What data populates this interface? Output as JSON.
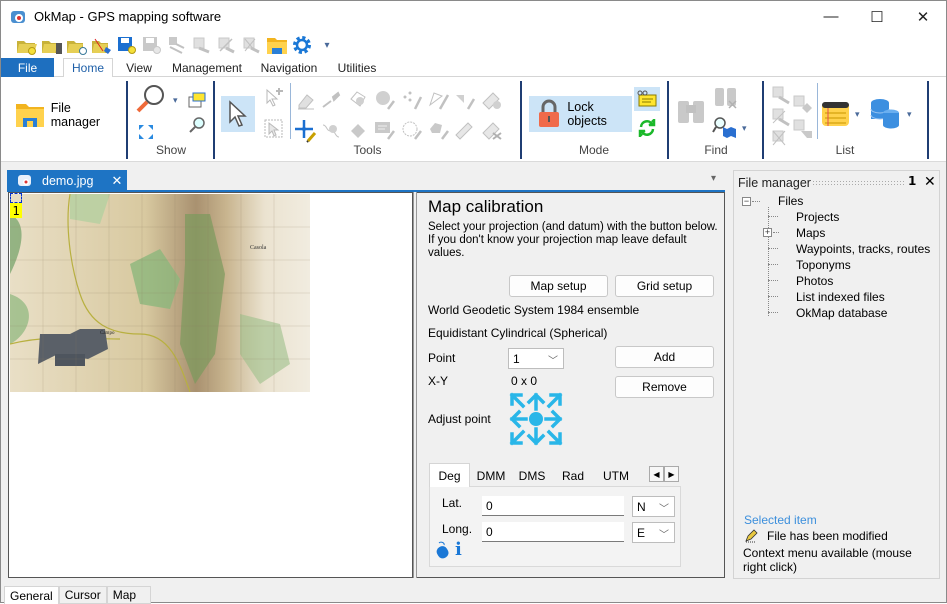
{
  "window": {
    "title": "OkMap - GPS mapping software",
    "controls": {
      "minimize": "—",
      "maximize": "☐",
      "close": "✕"
    }
  },
  "quick_access": {
    "items": [
      "open-project-icon",
      "open-device-icon",
      "open-web-icon",
      "open-track-icon",
      "save-icon",
      "save-web-icon",
      "export-icon",
      "export-grid-icon",
      "delete-grid-icon",
      "clear-grid-icon",
      "folder-icon",
      "settings-gear-icon"
    ],
    "customize": "▾"
  },
  "ribbon_tabs": {
    "file": "File",
    "tabs": [
      "Home",
      "View",
      "Management",
      "Navigation",
      "Utilities"
    ],
    "active": "Home"
  },
  "ribbon": {
    "file_manager": "File manager",
    "groups": {
      "show": "Show",
      "tools": "Tools",
      "mode": "Mode",
      "find": "Find",
      "list": "List"
    },
    "lock_objects": "Lock objects"
  },
  "document": {
    "tab_label": "demo.jpg",
    "close": "✕",
    "dropdown": "▾",
    "calibration_point_label": "1"
  },
  "calibration": {
    "title": "Map calibration",
    "description": "Select your projection (and datum) with the button below. If you don't know your projection map leave default values.",
    "map_setup": "Map setup",
    "grid_setup": "Grid setup",
    "datum": "World Geodetic System 1984 ensemble",
    "projection": "Equidistant Cylindrical (Spherical)",
    "point_label": "Point",
    "point_value": "1",
    "add": "Add",
    "remove": "Remove",
    "xy_label": "X-Y",
    "xy_value": "0 x 0",
    "adjust_label": "Adjust point",
    "coord_tabs": [
      "Deg",
      "DMM",
      "DMS",
      "Rad",
      "UTM"
    ],
    "coord_tab_active": "Deg",
    "lat_label": "Lat.",
    "lat_value": "0",
    "lat_hemi": "N",
    "long_label": "Long.",
    "long_value": "0",
    "long_hemi": "E"
  },
  "file_manager": {
    "title": "File manager",
    "root": "Files",
    "items": [
      "Projects",
      "Maps",
      "Waypoints, tracks, routes",
      "Toponyms",
      "Photos",
      "List indexed files",
      "OkMap database"
    ],
    "selected_item_title": "Selected item",
    "status": "File has been modified",
    "context_hint": "Context menu available (mouse right click)"
  },
  "bottom_tabs": [
    "General",
    "Cursor",
    "Map"
  ],
  "colors": {
    "accent": "#1e74c4",
    "file_tab": "#1e6fbf",
    "mode_highlight": "#cce4f7",
    "lock": "#f06a4a",
    "adjust_arrows": "#29b6e8",
    "selected_title": "#3c8fdc"
  }
}
